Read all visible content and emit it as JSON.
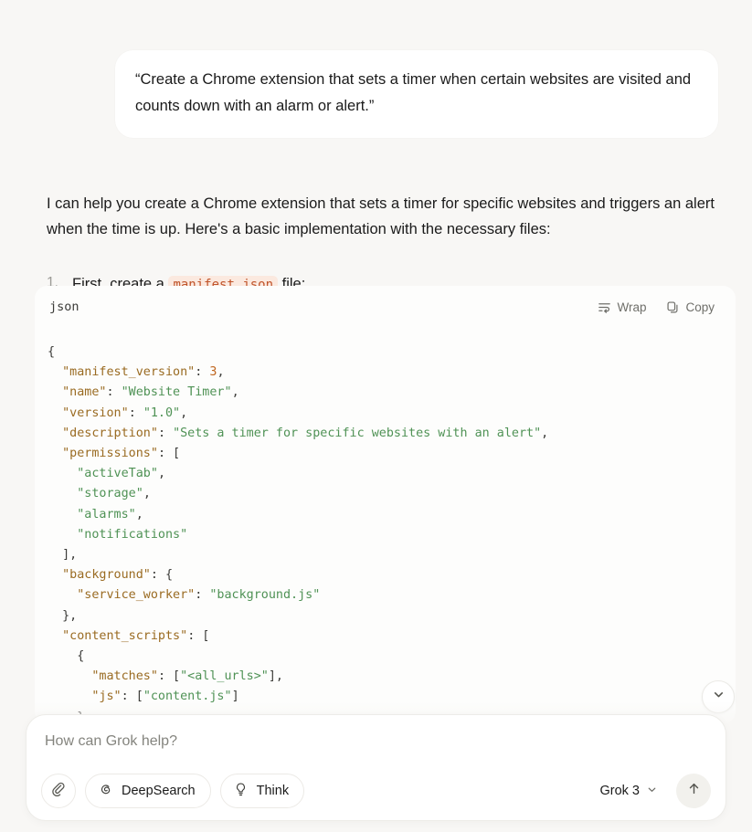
{
  "user_message": {
    "text": "“Create a Chrome extension that sets a timer when certain websites are visited and counts down with an alarm or alert.”"
  },
  "assistant": {
    "intro": "I can help you create a Chrome extension that sets a timer for specific websites and triggers an alert when the time is up. Here's a basic implementation with the necessary files:",
    "steps": [
      {
        "prefix": "First, create a ",
        "code": "manifest.json",
        "suffix": " file:"
      }
    ]
  },
  "code_block": {
    "language": "json",
    "wrap_label": "Wrap",
    "copy_label": "Copy",
    "lines": [
      [
        {
          "t": "punc",
          "s": "{"
        }
      ],
      [
        {
          "t": "punc",
          "s": "  "
        },
        {
          "t": "key",
          "s": "\"manifest_version\""
        },
        {
          "t": "punc",
          "s": ": "
        },
        {
          "t": "num",
          "s": "3"
        },
        {
          "t": "punc",
          "s": ","
        }
      ],
      [
        {
          "t": "punc",
          "s": "  "
        },
        {
          "t": "key",
          "s": "\"name\""
        },
        {
          "t": "punc",
          "s": ": "
        },
        {
          "t": "str",
          "s": "\"Website Timer\""
        },
        {
          "t": "punc",
          "s": ","
        }
      ],
      [
        {
          "t": "punc",
          "s": "  "
        },
        {
          "t": "key",
          "s": "\"version\""
        },
        {
          "t": "punc",
          "s": ": "
        },
        {
          "t": "str",
          "s": "\"1.0\""
        },
        {
          "t": "punc",
          "s": ","
        }
      ],
      [
        {
          "t": "punc",
          "s": "  "
        },
        {
          "t": "key",
          "s": "\"description\""
        },
        {
          "t": "punc",
          "s": ": "
        },
        {
          "t": "str",
          "s": "\"Sets a timer for specific websites with an alert\""
        },
        {
          "t": "punc",
          "s": ","
        }
      ],
      [
        {
          "t": "punc",
          "s": "  "
        },
        {
          "t": "key",
          "s": "\"permissions\""
        },
        {
          "t": "punc",
          "s": ": ["
        }
      ],
      [
        {
          "t": "punc",
          "s": "    "
        },
        {
          "t": "str",
          "s": "\"activeTab\""
        },
        {
          "t": "punc",
          "s": ","
        }
      ],
      [
        {
          "t": "punc",
          "s": "    "
        },
        {
          "t": "str",
          "s": "\"storage\""
        },
        {
          "t": "punc",
          "s": ","
        }
      ],
      [
        {
          "t": "punc",
          "s": "    "
        },
        {
          "t": "str",
          "s": "\"alarms\""
        },
        {
          "t": "punc",
          "s": ","
        }
      ],
      [
        {
          "t": "punc",
          "s": "    "
        },
        {
          "t": "str",
          "s": "\"notifications\""
        }
      ],
      [
        {
          "t": "punc",
          "s": "  ],"
        }
      ],
      [
        {
          "t": "punc",
          "s": "  "
        },
        {
          "t": "key",
          "s": "\"background\""
        },
        {
          "t": "punc",
          "s": ": {"
        }
      ],
      [
        {
          "t": "punc",
          "s": "    "
        },
        {
          "t": "key",
          "s": "\"service_worker\""
        },
        {
          "t": "punc",
          "s": ": "
        },
        {
          "t": "str",
          "s": "\"background.js\""
        }
      ],
      [
        {
          "t": "punc",
          "s": "  },"
        }
      ],
      [
        {
          "t": "punc",
          "s": "  "
        },
        {
          "t": "key",
          "s": "\"content_scripts\""
        },
        {
          "t": "punc",
          "s": ": ["
        }
      ],
      [
        {
          "t": "punc",
          "s": "    {"
        }
      ],
      [
        {
          "t": "punc",
          "s": "      "
        },
        {
          "t": "key",
          "s": "\"matches\""
        },
        {
          "t": "punc",
          "s": ": ["
        },
        {
          "t": "str",
          "s": "\"<all_urls>\""
        },
        {
          "t": "punc",
          "s": "],"
        }
      ],
      [
        {
          "t": "punc",
          "s": "      "
        },
        {
          "t": "key",
          "s": "\"js\""
        },
        {
          "t": "punc",
          "s": ": ["
        },
        {
          "t": "str",
          "s": "\"content.js\""
        },
        {
          "t": "punc",
          "s": "]"
        }
      ],
      [
        {
          "t": "punc",
          "s": "    }"
        }
      ],
      [
        {
          "t": "punc",
          "s": "  ]"
        }
      ]
    ]
  },
  "composer": {
    "placeholder": "How can Grok help?",
    "attach_label": "Attach",
    "deepsearch_label": "DeepSearch",
    "think_label": "Think",
    "model_label": "Grok 3",
    "send_label": "Send"
  },
  "colors": {
    "page_bg": "#f8f7f5",
    "bubble_bg": "#ffffff",
    "code_bg": "#fdfdfc",
    "inline_code_bg": "#fbe9df",
    "inline_code_fg": "#c0542a",
    "json_key": "#9a6b22",
    "json_string": "#4f9255",
    "json_number": "#c0661f",
    "text": "#1b1b1b",
    "muted": "#84847e"
  }
}
